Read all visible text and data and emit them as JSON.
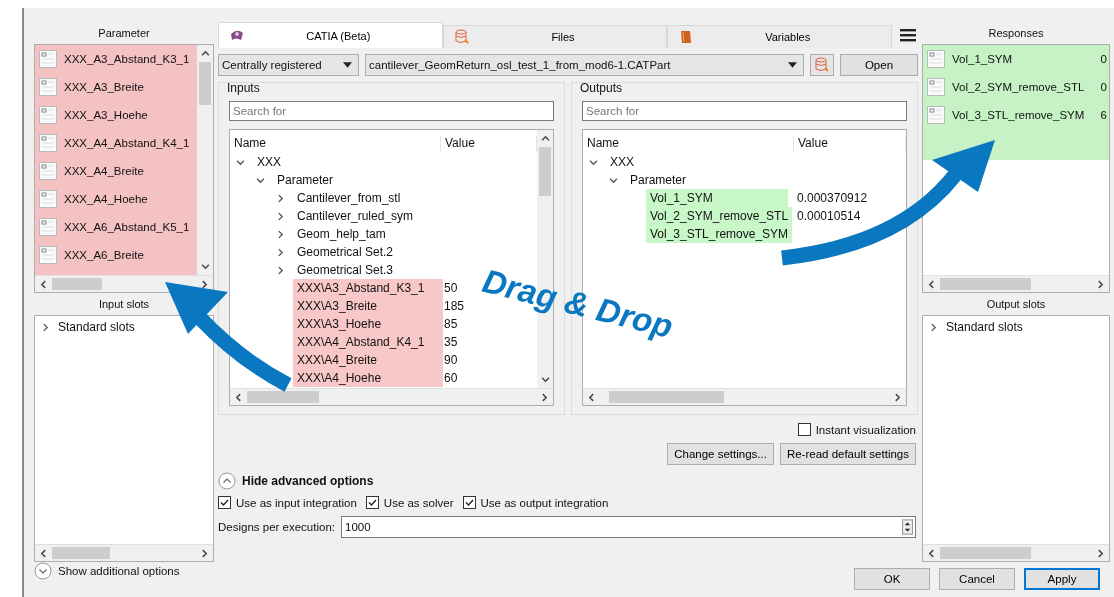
{
  "parameter_panel": {
    "title": "Parameter",
    "items": [
      {
        "label": "XXX_A3_Abstand_K3_1"
      },
      {
        "label": "XXX_A3_Breite"
      },
      {
        "label": "XXX_A3_Hoehe"
      },
      {
        "label": "XXX_A4_Abstand_K4_1"
      },
      {
        "label": "XXX_A4_Breite"
      },
      {
        "label": "XXX_A4_Hoehe"
      },
      {
        "label": "XXX_A6_Abstand_K5_1"
      },
      {
        "label": "XXX_A6_Breite"
      }
    ]
  },
  "input_slots": {
    "title": "Input slots",
    "items": [
      {
        "label": "Standard slots",
        "expanded": false
      }
    ]
  },
  "tabs": [
    {
      "label": "CATIA (Beta)",
      "selected": true
    },
    {
      "label": "Files",
      "selected": false
    },
    {
      "label": "Variables",
      "selected": false
    }
  ],
  "source_select": {
    "value": "Centrally registered"
  },
  "file_select": {
    "value": "cantilever_GeomReturn_osl_test_1_from_mod6-1.CATPart"
  },
  "open_button": "Open",
  "inputs": {
    "title": "Inputs",
    "search": {
      "placeholder": "Search for"
    },
    "columns": [
      "Name",
      "Value"
    ],
    "tree": [
      {
        "label": "XXX",
        "expanded": true,
        "children": [
          {
            "label": "Parameter",
            "expanded": true,
            "children": [
              {
                "label": "Cantilever_from_stl",
                "expanded": false
              },
              {
                "label": "Cantilever_ruled_sym",
                "expanded": false
              },
              {
                "label": "Geom_help_tam",
                "expanded": false
              },
              {
                "label": "Geometrical Set.2",
                "expanded": false
              },
              {
                "label": "Geometrical Set.3",
                "expanded": false
              },
              {
                "label": "XXX\\A3_Abstand_K3_1",
                "value": "50",
                "highlighted": true
              },
              {
                "label": "XXX\\A3_Breite",
                "value": "185",
                "highlighted": true
              },
              {
                "label": "XXX\\A3_Hoehe",
                "value": "85",
                "highlighted": true
              },
              {
                "label": "XXX\\A4_Abstand_K4_1",
                "value": "35",
                "highlighted": true
              },
              {
                "label": "XXX\\A4_Breite",
                "value": "90",
                "highlighted": true
              },
              {
                "label": "XXX\\A4_Hoehe",
                "value": "60",
                "highlighted": true
              }
            ]
          }
        ]
      }
    ]
  },
  "outputs": {
    "title": "Outputs",
    "search": {
      "placeholder": "Search for"
    },
    "columns": [
      "Name",
      "Value"
    ],
    "tree": [
      {
        "label": "XXX",
        "expanded": true,
        "children": [
          {
            "label": "Parameter",
            "expanded": true,
            "children": [
              {
                "label": "Vol_1_SYM",
                "value": "0.000370912",
                "highlighted": true
              },
              {
                "label": "Vol_2_SYM_remove_STL",
                "value": "0.00010514",
                "highlighted": true
              },
              {
                "label": "Vol_3_STL_remove_SYM",
                "highlighted": true
              }
            ]
          }
        ]
      }
    ]
  },
  "responses_panel": {
    "title": "Responses",
    "items": [
      {
        "label": "Vol_1_SYM",
        "value": "0"
      },
      {
        "label": "Vol_2_SYM_remove_STL",
        "value": "0"
      },
      {
        "label": "Vol_3_STL_remove_SYM",
        "value": "6"
      }
    ]
  },
  "output_slots": {
    "title": "Output slots",
    "items": [
      {
        "label": "Standard slots",
        "expanded": false
      }
    ]
  },
  "instant_visualization": {
    "label": "Instant visualization",
    "checked": false
  },
  "settings_buttons": [
    "Change settings...",
    "Re-read default settings"
  ],
  "advanced_toggle": {
    "label": "Hide advanced options",
    "expanded": true
  },
  "options": [
    {
      "label": "Use as input integration",
      "checked": true
    },
    {
      "label": "Use as solver",
      "checked": true
    },
    {
      "label": "Use as output integration",
      "checked": true
    }
  ],
  "designs_per_execution": {
    "label": "Designs per execution:",
    "value": "1000"
  },
  "additional_toggle": {
    "label": "Show additional options",
    "expanded": false
  },
  "dialog_buttons": [
    {
      "label": "OK",
      "default": false
    },
    {
      "label": "Cancel",
      "default": false
    },
    {
      "label": "Apply",
      "default": true
    }
  ],
  "overlay": {
    "caption": "Drag & Drop"
  }
}
